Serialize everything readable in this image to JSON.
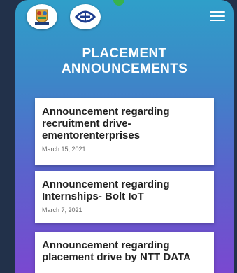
{
  "header": {
    "logos": [
      "college-crest-logo",
      "institution-emblem-logo"
    ],
    "menu_icon": "hamburger-menu-icon"
  },
  "page": {
    "heading_line1": "PLACEMENT",
    "heading_line2": "ANNOUNCEMENTS"
  },
  "announcements": [
    {
      "title": "Announcement regarding recruitment drive-ementorenterprises",
      "date": "March 15, 2021"
    },
    {
      "title": "Announcement regarding Internships- Bolt IoT",
      "date": "March 7, 2021"
    },
    {
      "title": "Announcement regarding placement drive by NTT DATA",
      "date": ""
    }
  ],
  "colors": {
    "gradient_top": "#2f9fc9",
    "gradient_bottom": "#7a48d0",
    "card_bg": "#ffffff",
    "title_text": "#222222"
  }
}
